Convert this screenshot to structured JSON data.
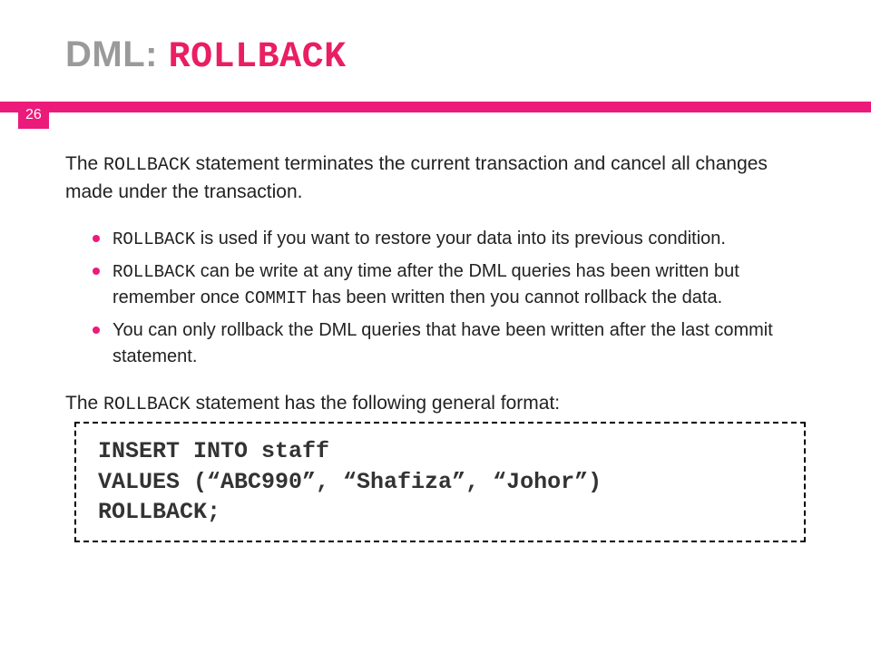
{
  "title": {
    "prefix": "DML: ",
    "keyword": "ROLLBACK"
  },
  "page_number": "26",
  "intro": {
    "pre": "The ",
    "kw": "ROLLBACK",
    "post": " statement terminates the current transaction and cancel all changes made under the transaction."
  },
  "bullets": [
    {
      "kw": "ROLLBACK",
      "post": "  is used if you want to restore your data into its previous condition."
    },
    {
      "kw": "ROLLBACK",
      "mid": " can be write at any time after the DML queries has been written but remember once ",
      "kw2": "COMMIT",
      "post2": " has been written then you cannot rollback the data."
    },
    {
      "plain": "You can only rollback the DML queries that have been written after the last commit statement."
    }
  ],
  "format_intro": {
    "pre": "The ",
    "kw": "ROLLBACK",
    "post": " statement has the following general format:"
  },
  "code": "INSERT INTO staff\nVALUES (“ABC990”, “Shafiza”, “Johor”)\nROLLBACK;"
}
